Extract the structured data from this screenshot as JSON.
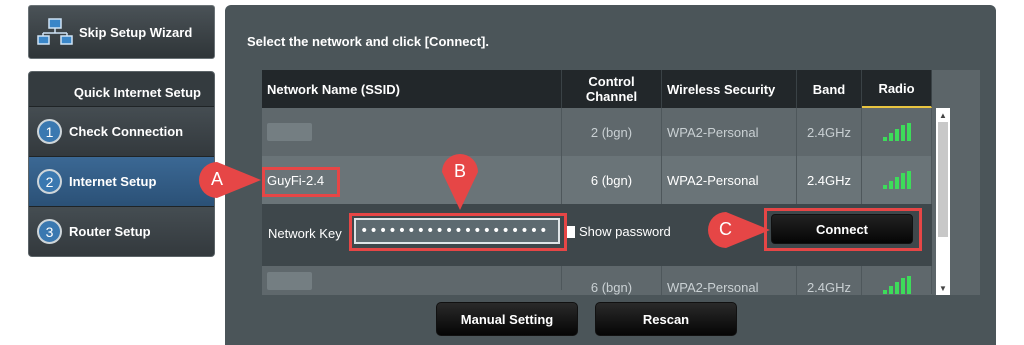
{
  "sidebar": {
    "skip_wizard": "Skip Setup Wizard",
    "panel_title": "Quick Internet Setup",
    "steps": [
      {
        "num": "1",
        "label": "Check Connection"
      },
      {
        "num": "2",
        "label": "Internet Setup"
      },
      {
        "num": "3",
        "label": "Router Setup"
      }
    ],
    "active_step": "Internet Setup"
  },
  "main": {
    "instruction": "Select the network and click [Connect].",
    "table": {
      "headers": {
        "ssid": "Network Name (SSID)",
        "channel_line1": "Control",
        "channel_line2": "Channel",
        "security": "Wireless Security",
        "band": "Band",
        "radio": "Radio"
      },
      "rows": [
        {
          "ssid": "",
          "channel": "2 (bgn)",
          "security": "WPA2-Personal",
          "band": "2.4GHz",
          "signal": 4
        },
        {
          "ssid": "GuyFi-2.4",
          "channel": "6 (bgn)",
          "security": "WPA2-Personal",
          "band": "2.4GHz",
          "signal": 4
        },
        {
          "ssid": "",
          "channel": "6 (bgn)",
          "security": "WPA2-Personal",
          "band": "2.4GHz",
          "signal": 4
        }
      ],
      "selected_row": "GuyFi-2.4"
    },
    "network_key": {
      "label": "Network Key",
      "value": "••••••••••••••••••••",
      "show_password_label": "Show password"
    },
    "connect_label": "Connect",
    "manual_setting_label": "Manual Setting",
    "rescan_label": "Rescan"
  },
  "callouts": {
    "a": "A",
    "b": "B",
    "c": "C"
  },
  "colors": {
    "highlight": "#e64646",
    "signal": "#3ddc5a",
    "accent_underline": "#e8c440"
  }
}
